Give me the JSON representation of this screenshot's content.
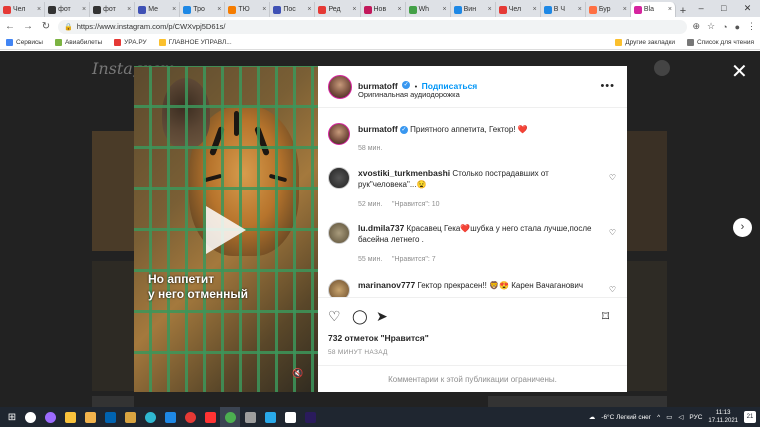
{
  "browser": {
    "tabs": [
      {
        "label": "Чел",
        "color": "#e53935"
      },
      {
        "label": "фот",
        "color": "#333333"
      },
      {
        "label": "фот",
        "color": "#333333"
      },
      {
        "label": "Ме",
        "color": "#3f51b5"
      },
      {
        "label": "Тро",
        "color": "#1e88e5"
      },
      {
        "label": "ТЮ",
        "color": "#f57c00"
      },
      {
        "label": "Пос",
        "color": "#3f51b5"
      },
      {
        "label": "Ред",
        "color": "#e53935"
      },
      {
        "label": "Нов",
        "color": "#c2185b"
      },
      {
        "label": "Wh",
        "color": "#43a047"
      },
      {
        "label": "Вин",
        "color": "#1e88e5"
      },
      {
        "label": "Чел",
        "color": "#e53935"
      },
      {
        "label": "В Ч",
        "color": "#1e88e5"
      },
      {
        "label": "Бур",
        "color": "#ff7043"
      },
      {
        "label": "Bla",
        "color": "#d6249f",
        "active": true
      }
    ],
    "url": "https://www.instagram.com/p/CWXvpj5D61s/",
    "bookmarks": [
      "Сервисы",
      "Авиабилеты",
      "УРА.РУ",
      "ГЛАВНОЕ УПРАВЛ..."
    ],
    "bookmarks_right": [
      "Другие закладки",
      "Список для чтения"
    ]
  },
  "page": {
    "logo": "Instagram"
  },
  "video": {
    "caption_line1": "Но аппетит",
    "caption_line2": "у него отменный"
  },
  "post": {
    "author": "burmatoff",
    "follow_label": "Подписаться",
    "audio": "Оригинальная аудиодорожка",
    "separator": "•",
    "caption_text": "Приятного аппетита, Гектор! ❤️",
    "caption_time": "58 мин.",
    "comments": [
      {
        "user": "xvostiki_turkmenbashi",
        "text": "Столько пострадавших от рук\"человека\"...😧",
        "time": "52 мин.",
        "likes": "\"Нравится\": 10"
      },
      {
        "user": "lu.dmila737",
        "text": "Красавец Гека❤️шубка у него стала лучше,после басейна летнего .",
        "time": "55 мин.",
        "likes": "\"Нравится\": 7"
      },
      {
        "user": "marinanov777",
        "text": "Гектор прекрасен!! 🦁😍 Карен Вачаганович",
        "time": "",
        "likes": ""
      }
    ],
    "likes_count": "732 отметок \"Нравится\"",
    "timestamp": "58 МИНУТ НАЗАД",
    "comments_limited": "Комментарии к этой публикации ограничены."
  },
  "taskbar": {
    "weather": "-6°C Легкий снег",
    "lang": "РУС",
    "time": "11:13",
    "date": "17.11.2021",
    "notifications": "21",
    "icons": [
      {
        "name": "search-icon",
        "color": "#ffffff"
      },
      {
        "name": "cortana-icon",
        "color": "#9c6bff"
      },
      {
        "name": "file-explorer-icon",
        "color": "#f9c23c"
      },
      {
        "name": "files-icon",
        "color": "#f2b34c"
      },
      {
        "name": "photos-icon",
        "color": "#0063b1"
      },
      {
        "name": "game-icon",
        "color": "#d9a441"
      },
      {
        "name": "edge-icon",
        "color": "#2fb8d2"
      },
      {
        "name": "mail-icon",
        "color": "#1e88e5"
      },
      {
        "name": "opera-icon",
        "color": "#e53935"
      },
      {
        "name": "yandex-icon",
        "color": "#ff3333"
      },
      {
        "name": "chrome-icon",
        "color": "#4caf50"
      },
      {
        "name": "screenshot-icon",
        "color": "#9e9e9e"
      },
      {
        "name": "telegram-icon",
        "color": "#29a9ea"
      },
      {
        "name": "store-icon",
        "color": "#ffffff"
      },
      {
        "name": "premiere-icon",
        "color": "#2a1b5c"
      }
    ]
  }
}
